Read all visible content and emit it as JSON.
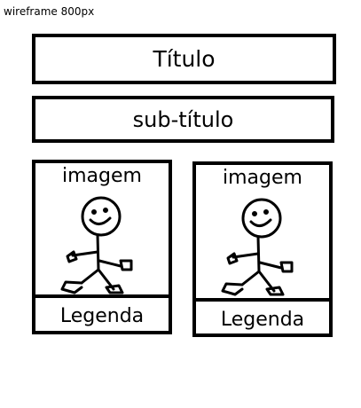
{
  "caption": "wireframe 800px",
  "title": "Título",
  "subtitle": "sub-título",
  "cards": [
    {
      "label": "imagem",
      "caption": "Legenda",
      "icon": "stick-figure-icon"
    },
    {
      "label": "imagem",
      "caption": "Legenda",
      "icon": "stick-figure-icon"
    }
  ]
}
